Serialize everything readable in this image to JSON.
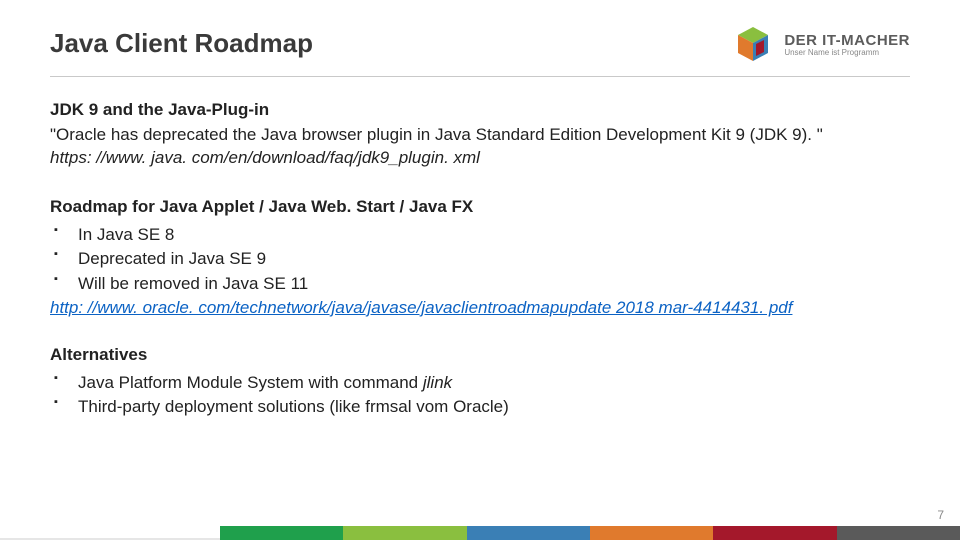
{
  "header": {
    "title": "Java Client Roadmap",
    "brand_main": "DER IT-MACHER",
    "brand_sub": "Unser Name ist Programm"
  },
  "section_jdk9": {
    "heading": "JDK 9 and the Java-Plug-in",
    "quote": "\"Oracle has deprecated the Java browser plugin in Java Standard Edition Development Kit 9 (JDK 9). \"",
    "source": "https: //www. java. com/en/download/faq/jdk9_plugin. xml"
  },
  "section_roadmap": {
    "heading": "Roadmap for Java Applet / Java Web. Start / Java FX",
    "items": [
      "In Java SE 8",
      "Deprecated in Java SE 9",
      "Will be removed in Java SE 11"
    ],
    "link": "http: //www. oracle. com/technetwork/java/javase/javaclientroadmapupdate 2018 mar-4414431. pdf"
  },
  "section_alt": {
    "heading": "Alternatives",
    "items": [
      {
        "prefix": "Java Platform Module System with command ",
        "em": "jlink",
        "suffix": ""
      },
      {
        "prefix": "Third-party deployment solutions (like frmsal vom Oracle)",
        "em": "",
        "suffix": ""
      }
    ]
  },
  "page_number": "7",
  "colors": {
    "green": "#1fa04c",
    "lime": "#8abf3f",
    "blue": "#3a7fb5",
    "orange": "#e07a2d",
    "red": "#a4182b",
    "gray": "#5a5a5a"
  }
}
